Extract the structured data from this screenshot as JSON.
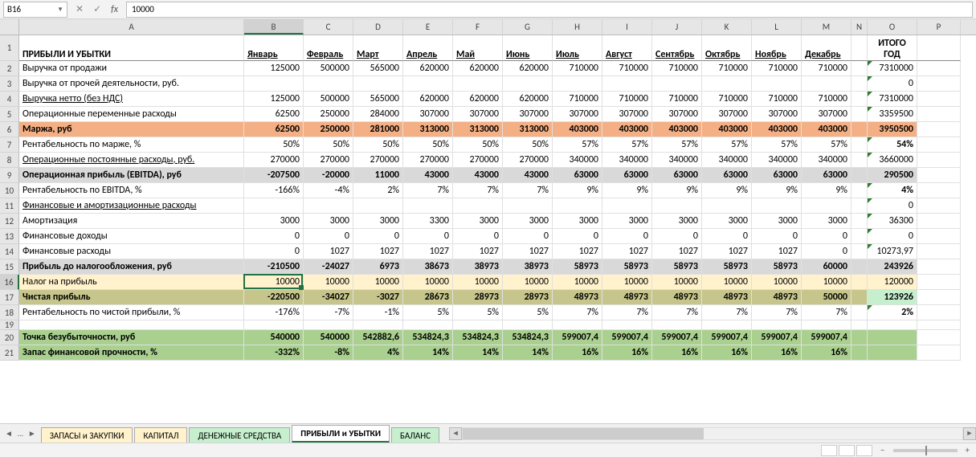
{
  "name_box": "B16",
  "formula_value": "10000",
  "columns": [
    "A",
    "B",
    "C",
    "D",
    "E",
    "F",
    "G",
    "H",
    "I",
    "J",
    "K",
    "L",
    "M",
    "N",
    "O",
    "P"
  ],
  "headers": {
    "title": "ПРИБЫЛИ И УБЫТКИ",
    "months": [
      "Январь",
      "Февраль",
      "Март",
      "Апрель",
      "Май",
      "Июнь",
      "Июль",
      "Август",
      "Сентябрь",
      "Октябрь",
      "Ноябрь",
      "Декабрь"
    ],
    "total": "ИТОГО ГОД"
  },
  "rows": [
    {
      "n": 2,
      "label": "Выручка от продажи",
      "vals": [
        "125000",
        "500000",
        "565000",
        "620000",
        "620000",
        "620000",
        "710000",
        "710000",
        "710000",
        "710000",
        "710000",
        "710000"
      ],
      "total": "7310000"
    },
    {
      "n": 3,
      "label": "Выручка от прочей деятельности, руб.",
      "vals": [
        "",
        "",
        "",
        "",
        "",
        "",
        "",
        "",
        "",
        "",
        "",
        ""
      ],
      "total": "0"
    },
    {
      "n": 4,
      "label": "Выручка нетто (без НДС)",
      "vals": [
        "125000",
        "500000",
        "565000",
        "620000",
        "620000",
        "620000",
        "710000",
        "710000",
        "710000",
        "710000",
        "710000",
        "710000"
      ],
      "total": "7310000",
      "under": true
    },
    {
      "n": 5,
      "label": "Операционные переменные расходы",
      "vals": [
        "62500",
        "250000",
        "284000",
        "307000",
        "307000",
        "307000",
        "307000",
        "307000",
        "307000",
        "307000",
        "307000",
        "307000"
      ],
      "total": "3359500"
    },
    {
      "n": 6,
      "label": "Маржа, руб",
      "vals": [
        "62500",
        "250000",
        "281000",
        "313000",
        "313000",
        "313000",
        "403000",
        "403000",
        "403000",
        "403000",
        "403000",
        "403000"
      ],
      "total": "3950500",
      "bold": true,
      "fill": "orange"
    },
    {
      "n": 7,
      "label": "Рентабельность по марже, %",
      "vals": [
        "50%",
        "50%",
        "50%",
        "50%",
        "50%",
        "50%",
        "57%",
        "57%",
        "57%",
        "57%",
        "57%",
        "57%"
      ],
      "total": "54%",
      "bold_total": true
    },
    {
      "n": 8,
      "label": "Операционные постоянные расходы, руб.",
      "vals": [
        "270000",
        "270000",
        "270000",
        "270000",
        "270000",
        "270000",
        "340000",
        "340000",
        "340000",
        "340000",
        "340000",
        "340000"
      ],
      "total": "3660000",
      "under": true
    },
    {
      "n": 9,
      "label": "Операционная прибыль (EBITDA), руб",
      "vals": [
        "-207500",
        "-20000",
        "11000",
        "43000",
        "43000",
        "43000",
        "63000",
        "63000",
        "63000",
        "63000",
        "63000",
        "63000"
      ],
      "total": "290500",
      "bold": true,
      "fill": "grey"
    },
    {
      "n": 10,
      "label": "Рентабельность по EBITDA, %",
      "vals": [
        "-166%",
        "-4%",
        "2%",
        "7%",
        "7%",
        "7%",
        "9%",
        "9%",
        "9%",
        "9%",
        "9%",
        "9%"
      ],
      "total": "4%",
      "bold_total": true
    },
    {
      "n": 11,
      "label": "Финансовые и амортизационные расходы",
      "vals": [
        "",
        "",
        "",
        "",
        "",
        "",
        "",
        "",
        "",
        "",
        "",
        ""
      ],
      "total": "0",
      "under": true
    },
    {
      "n": 12,
      "label": "Амортизация",
      "vals": [
        "3000",
        "3000",
        "3000",
        "3300",
        "3000",
        "3000",
        "3000",
        "3000",
        "3000",
        "3000",
        "3000",
        "3000"
      ],
      "total": "36300"
    },
    {
      "n": 13,
      "label": "Финансовые доходы",
      "vals": [
        "0",
        "0",
        "0",
        "0",
        "0",
        "0",
        "0",
        "0",
        "0",
        "0",
        "0",
        "0"
      ],
      "total": "0"
    },
    {
      "n": 14,
      "label": "Финансовые расходы",
      "vals": [
        "0",
        "1027",
        "1027",
        "1027",
        "1027",
        "1027",
        "1027",
        "1027",
        "1027",
        "1027",
        "1027",
        "0"
      ],
      "total": "10273,97"
    },
    {
      "n": 15,
      "label": "Прибыль до налогообложения, руб",
      "vals": [
        "-210500",
        "-24027",
        "6973",
        "38673",
        "38973",
        "38973",
        "58973",
        "58973",
        "58973",
        "58973",
        "58973",
        "60000"
      ],
      "total": "243926",
      "bold": true,
      "fill": "grey"
    },
    {
      "n": 16,
      "label": "Налог на прибыль",
      "vals": [
        "10000",
        "10000",
        "10000",
        "10000",
        "10000",
        "10000",
        "10000",
        "10000",
        "10000",
        "10000",
        "10000",
        "10000"
      ],
      "total": "120000",
      "fill": "cream",
      "active": true
    },
    {
      "n": 17,
      "label": "Чистая прибыль",
      "vals": [
        "-220500",
        "-34027",
        "-3027",
        "28673",
        "28973",
        "28973",
        "48973",
        "48973",
        "48973",
        "48973",
        "48973",
        "50000"
      ],
      "total": "123926",
      "bold": true,
      "fill": "olive",
      "total_fill": "green2"
    },
    {
      "n": 18,
      "label": "Рентабельность по чистой прибыли, %",
      "vals": [
        "-176%",
        "-7%",
        "-1%",
        "5%",
        "5%",
        "5%",
        "7%",
        "7%",
        "7%",
        "7%",
        "7%",
        "7%"
      ],
      "total": "2%",
      "bold_total": true
    },
    {
      "n": 19,
      "label": "",
      "vals": [
        "",
        "",
        "",
        "",
        "",
        "",
        "",
        "",
        "",
        "",
        "",
        ""
      ],
      "total": "",
      "spacer": true
    },
    {
      "n": 20,
      "label": "Точка безубыточности, руб",
      "vals": [
        "540000",
        "540000",
        "542882,6",
        "534824,3",
        "534824,3",
        "534824,3",
        "599007,4",
        "599007,4",
        "599007,4",
        "599007,4",
        "599007,4",
        "599007,4"
      ],
      "total": "",
      "bold": true,
      "fill": "green1"
    },
    {
      "n": 21,
      "label": "Запас финансовой прочности, %",
      "vals": [
        "-332%",
        "-8%",
        "4%",
        "14%",
        "14%",
        "14%",
        "16%",
        "16%",
        "16%",
        "16%",
        "16%",
        "16%"
      ],
      "total": "",
      "bold": true,
      "fill": "green1"
    }
  ],
  "tabs": {
    "nav_dots": "…",
    "list": [
      {
        "label": "ЗАПАСЫ и ЗАКУПКИ",
        "cls": "yellow"
      },
      {
        "label": "КАПИТАЛ",
        "cls": "yellow"
      },
      {
        "label": "ДЕНЕЖНЫЕ СРЕДСТВА",
        "cls": "green"
      },
      {
        "label": "ПРИБЫЛИ и УБЫТКИ",
        "cls": "active"
      },
      {
        "label": "БАЛАНС",
        "cls": "green"
      }
    ]
  },
  "status": {
    "zoom_minus": "−",
    "zoom_plus": "+"
  }
}
